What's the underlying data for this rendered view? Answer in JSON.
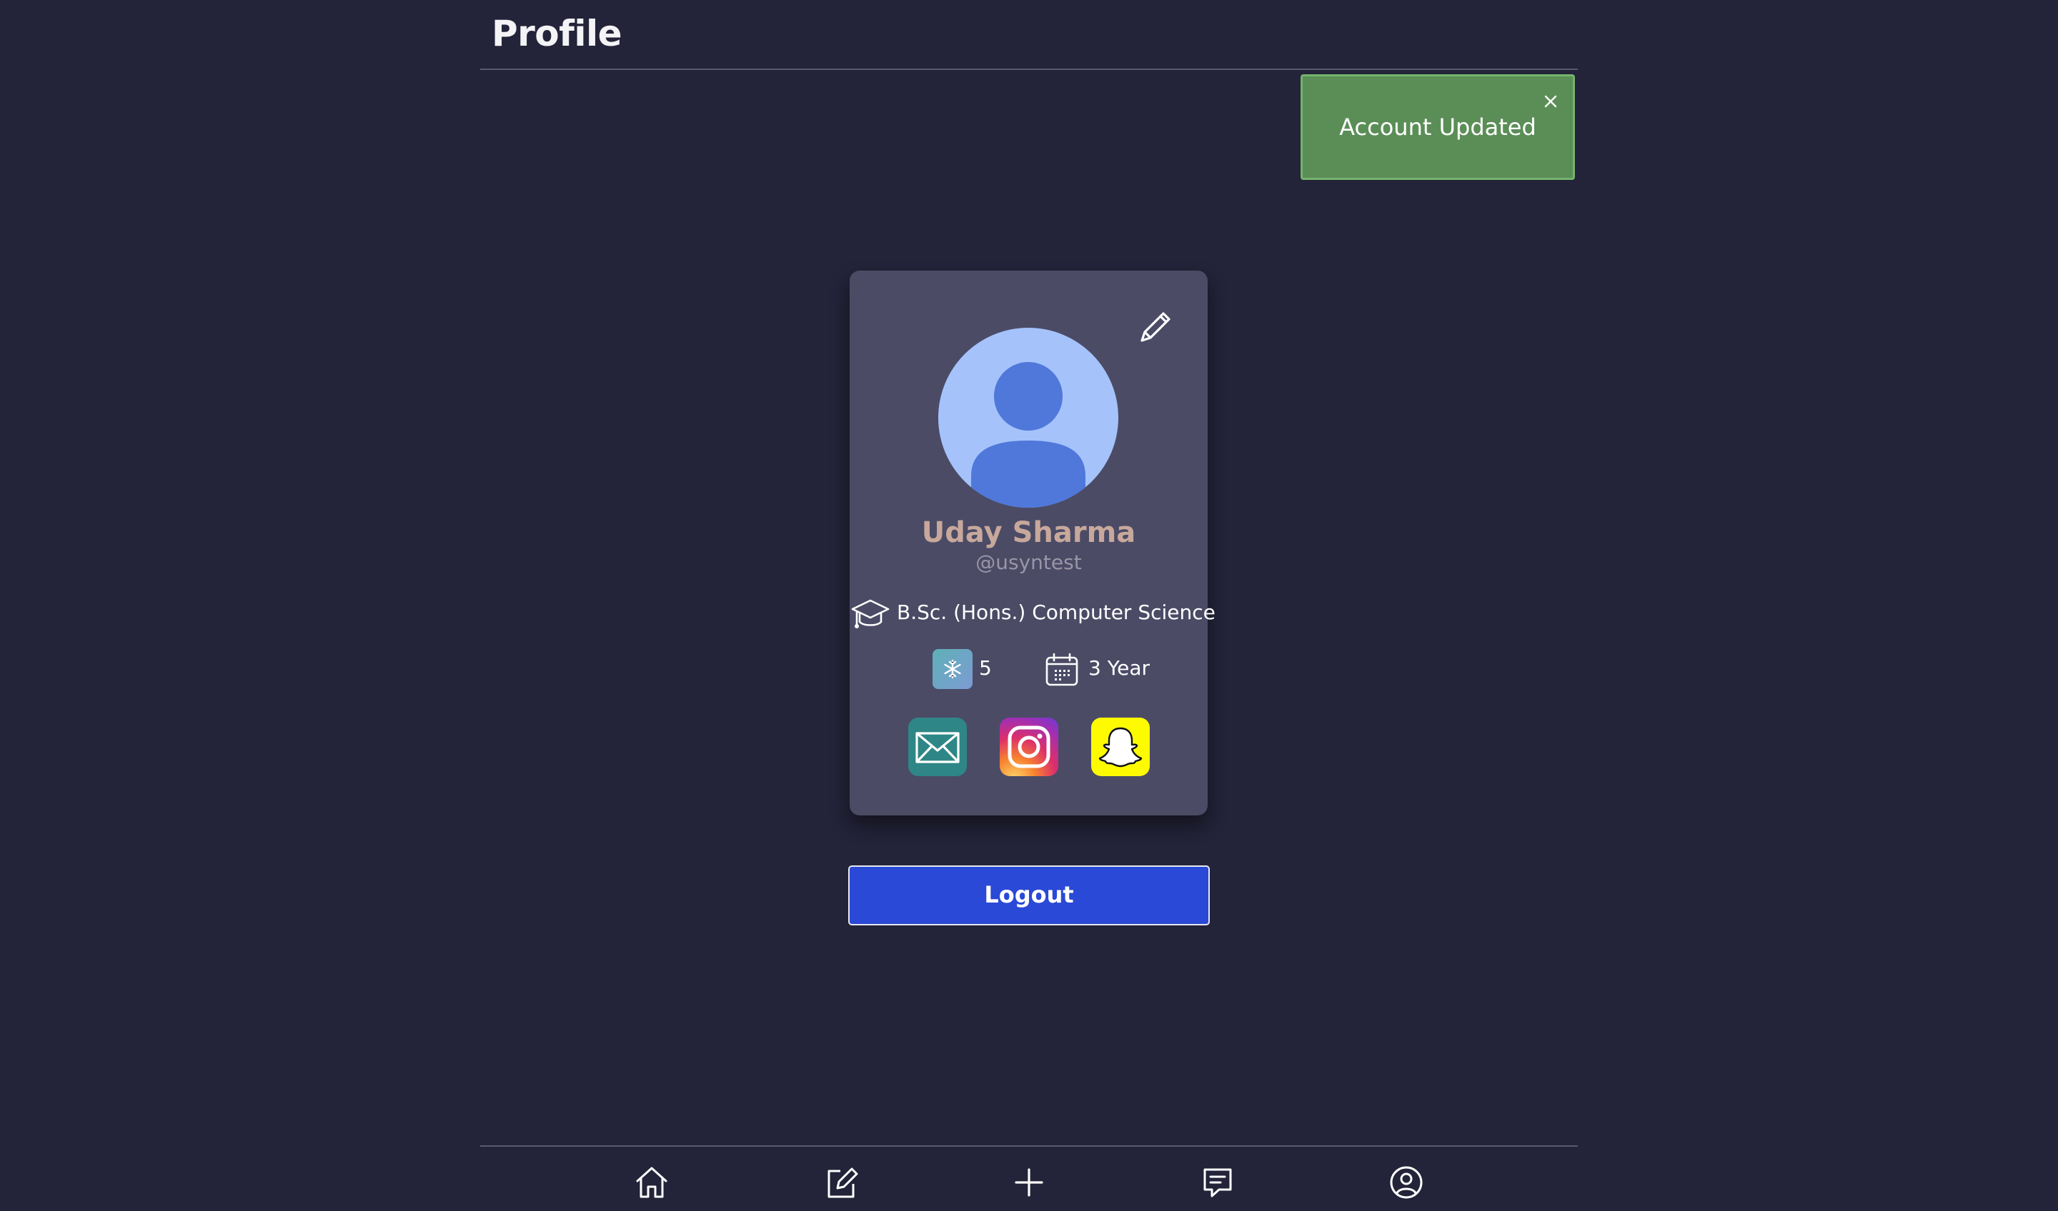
{
  "header": {
    "title": "Profile"
  },
  "toast": {
    "message": "Account Updated",
    "close_icon": "close-icon",
    "color": "#5b8e57"
  },
  "profile": {
    "name": "Uday Sharma",
    "handle": "@usyntest",
    "course": "B.Sc. (Hons.) Computer Science",
    "streak": "5",
    "year": "3 Year",
    "icons": {
      "edit": "pencil-icon",
      "course": "graduation-cap-icon",
      "streak": "snowflake-icon",
      "year": "calendar-icon",
      "avatar": "user-avatar-icon"
    },
    "socials": [
      {
        "name": "email",
        "icon": "mail-icon",
        "color": "#2f8686"
      },
      {
        "name": "instagram",
        "icon": "instagram-icon",
        "color": "#dc2f6a"
      },
      {
        "name": "snapchat",
        "icon": "snapchat-icon",
        "color": "#fefb00"
      }
    ]
  },
  "actions": {
    "logout_label": "Logout",
    "logout_color": "#2a49d6"
  },
  "bottom_nav": {
    "items": [
      {
        "name": "home",
        "icon": "home-icon"
      },
      {
        "name": "write",
        "icon": "edit-square-icon"
      },
      {
        "name": "create",
        "icon": "plus-icon"
      },
      {
        "name": "chat",
        "icon": "chat-icon"
      },
      {
        "name": "profile",
        "icon": "account-circle-icon"
      }
    ]
  },
  "theme": {
    "background": "#232339",
    "card": "#4b4b66",
    "name_color": "#c7a89b"
  }
}
